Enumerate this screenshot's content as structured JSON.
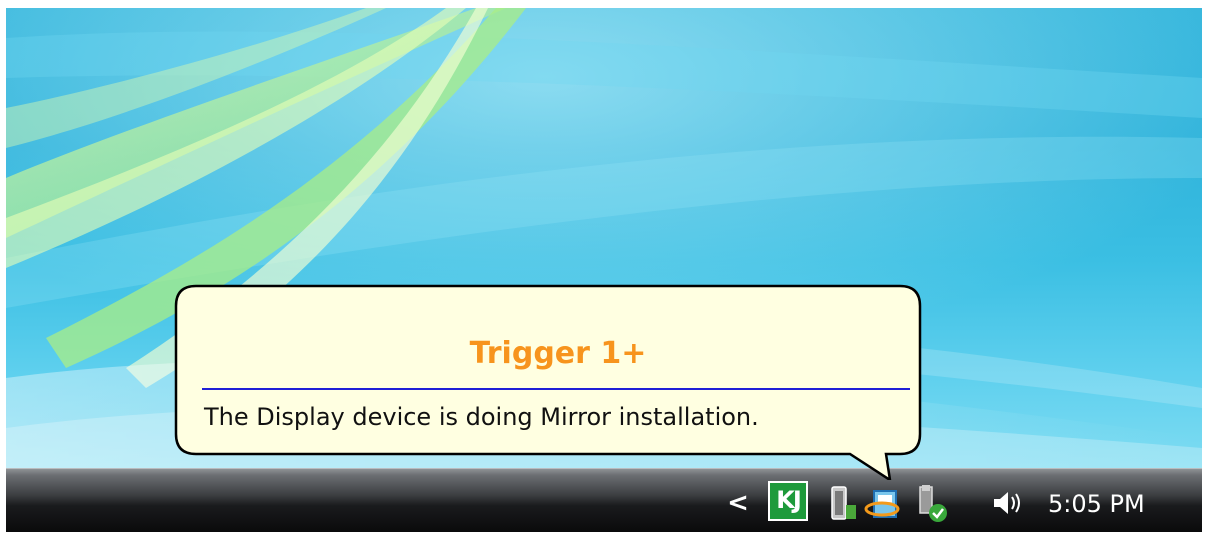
{
  "balloon": {
    "title": "Trigger 1+",
    "message": "The Display device is doing Mirror installation."
  },
  "taskbar": {
    "tray_chevron": "<",
    "tray_icons": [
      {
        "name": "kj-icon",
        "label": "KJ"
      },
      {
        "name": "battery-icon"
      },
      {
        "name": "trigger-display-icon"
      },
      {
        "name": "usb-safe-remove-icon"
      },
      {
        "name": "speaker-volume-icon"
      }
    ],
    "clock": "5:05 PM"
  },
  "colors": {
    "balloon_bg": "#ffffe1",
    "balloon_title": "#f7941d",
    "balloon_rule": "#1f1fd6",
    "kj_green": "#1e9a3b",
    "taskbar": "#1a1b1d",
    "wallpaper": "#35b6dc"
  }
}
